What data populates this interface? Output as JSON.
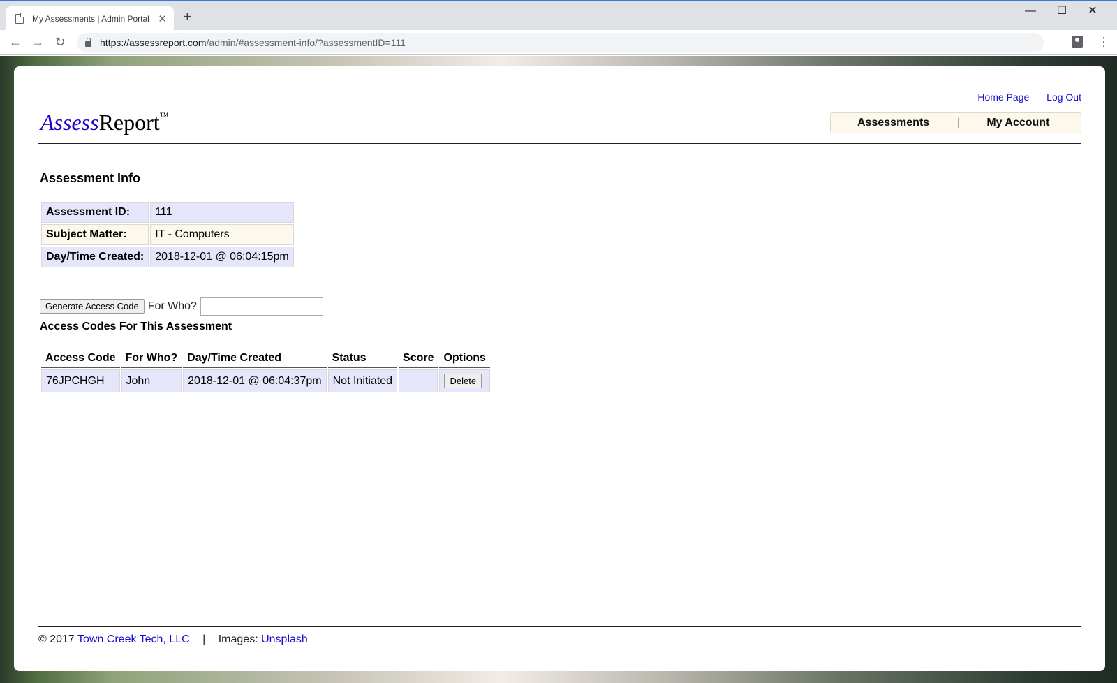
{
  "browser": {
    "tab_title": "My Assessments | Admin Portal",
    "tab_close": "✕",
    "new_tab": "+",
    "url_host": "https://assessreport.com",
    "url_path": "/admin/#assessment-info/?assessmentID=111",
    "win_minimize": "—",
    "win_maximize": "☐",
    "win_close": "✕",
    "back": "←",
    "forward": "→",
    "reload": "↻",
    "menu": "⋮"
  },
  "header": {
    "links": {
      "home": "Home Page",
      "logout": "Log Out"
    },
    "logo": {
      "accent": "Assess",
      "rest": "Report",
      "tm": "™"
    },
    "nav": {
      "assessments": "Assessments",
      "separator": "|",
      "account": "My Account"
    }
  },
  "assessment_info": {
    "title": "Assessment Info",
    "rows": [
      {
        "label": "Assessment ID:",
        "value": "111"
      },
      {
        "label": "Subject Matter:",
        "value": "IT - Computers"
      },
      {
        "label": "Day/Time Created:",
        "value": "2018-12-01 @ 06:04:15pm"
      }
    ]
  },
  "generate": {
    "button": "Generate Access Code",
    "label": "For Who?",
    "input_value": ""
  },
  "access_codes": {
    "title": "Access Codes For This Assessment",
    "columns": [
      "Access Code",
      "For Who?",
      "Day/Time Created",
      "Status",
      "Score",
      "Options"
    ],
    "rows": [
      {
        "code": "76JPCHGH",
        "for_who": "John",
        "created": "2018-12-01 @ 06:04:37pm",
        "status": "Not Initiated",
        "score": "",
        "option_button": "Delete"
      }
    ]
  },
  "footer": {
    "copyright": "© 2017",
    "company": "Town Creek Tech, LLC",
    "separator": "|",
    "images_label": "Images:",
    "images_link": "Unsplash"
  },
  "colors": {
    "link": "#1a0dcc",
    "logo_accent": "#2200cc",
    "row_blue": "#e6e6fa",
    "row_cream": "#fdf8ec"
  }
}
